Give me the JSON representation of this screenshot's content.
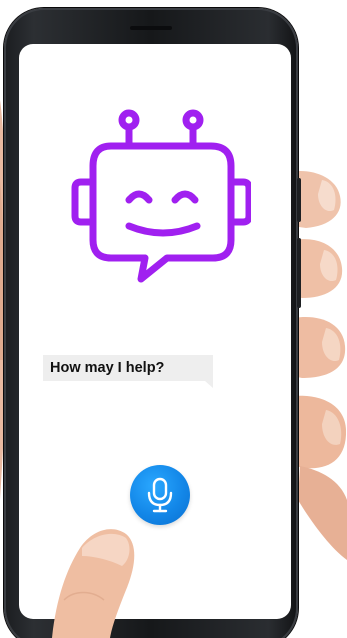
{
  "assistant": {
    "prompt_text": "How may I help?",
    "bot_icon": "chatbot-face-icon",
    "mic_icon": "microphone-icon"
  },
  "colors": {
    "accent_purple": "#a020f0",
    "mic_blue": "#1387e8",
    "bubble_gray": "#eeeeee"
  }
}
